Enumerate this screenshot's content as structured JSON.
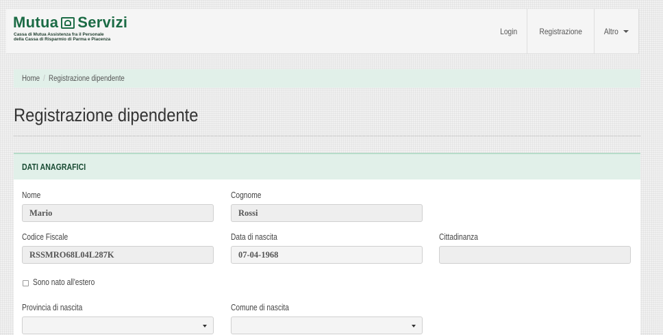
{
  "brand": {
    "name_part1": "Mutua",
    "name_part2": "Servizi",
    "tagline_line1": "Cassa di Mutua Assistenza fra il Personale",
    "tagline_line2": "della Cassa di Risparmio di Parma e Piacenza",
    "color": "#1b6b45"
  },
  "nav": {
    "login": "Login",
    "registrazione": "Registrazione",
    "altro": "Altro"
  },
  "breadcrumb": {
    "home": "Home",
    "separator": "/",
    "current": "Registrazione dipendente"
  },
  "page": {
    "title": "Registrazione dipendente"
  },
  "panel": {
    "heading": "DATI ANAGRAFICI",
    "fields": {
      "nome": {
        "label": "Nome",
        "value": "Mario"
      },
      "cognome": {
        "label": "Cognome",
        "value": "Rossi"
      },
      "codice_fiscale": {
        "label": "Codice Fiscale",
        "value": "RSSMRO68L04L287K"
      },
      "data_nascita": {
        "label": "Data di nascita",
        "value": "07-04-1968"
      },
      "cittadinanza": {
        "label": "Cittadinanza",
        "value": ""
      },
      "nato_estero": {
        "label": "Sono nato all'estero",
        "checked": false
      },
      "provincia_nascita": {
        "label": "Provincia di nascita",
        "value": ""
      },
      "comune_nascita": {
        "label": "Comune di nascita",
        "value": ""
      }
    }
  },
  "colors": {
    "accent_bg": "#e1f0e9",
    "heading_text": "#1b4d35"
  }
}
